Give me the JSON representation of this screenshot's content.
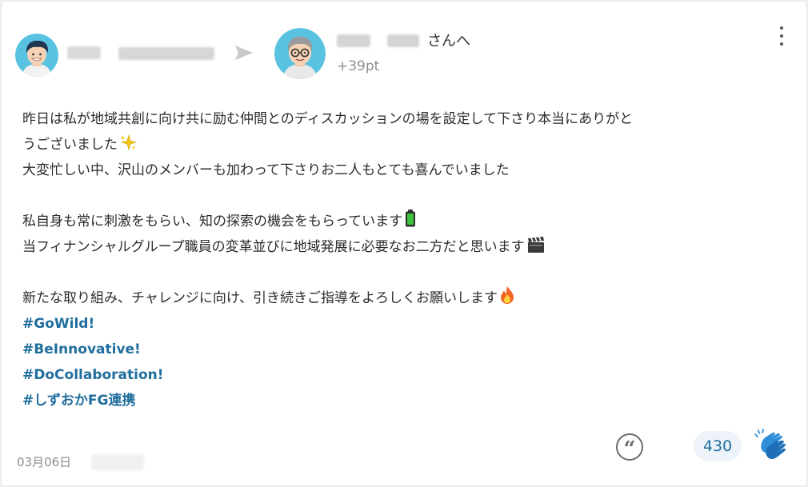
{
  "post": {
    "sender": {
      "name_redacted": true,
      "avatar_icon": "avatar-man-dark-hair-icon"
    },
    "recipient": {
      "name_suffix": "さんへ",
      "points": "+39pt",
      "avatar_icon": "avatar-man-glasses-icon"
    },
    "arrow_icon": "arrow-right-icon",
    "menu_icon": "more-vertical-icon",
    "message": {
      "line1": "昨日は私が地域共創に向け共に励む仲間とのディスカッションの場を設定して下さり本当にありがと",
      "line2": "うございました",
      "line3": "大変忙しい中、沢山のメンバーも加わって下さりお二人もとても喜んでいました",
      "line4": "私自身も常に刺激をもらい、知の探索の機会をもらっています",
      "line5": "当フィナンシャルグループ職員の変革並びに地域発展に必要なお二方だと思います",
      "line6": "新たな取り組み、チャレンジに向け、引き続きご指導をよろしくお願いします"
    },
    "hashtags": [
      "#GoWild!",
      "#BeInnovative!",
      "#DoCollaboration!",
      "#しずおかFG連携"
    ],
    "date": "03月06日",
    "quote_icon": "quote-icon",
    "clap_count": "430",
    "clap_icon": "clapping-hands-icon",
    "colors": {
      "accent": "#1f6e9d",
      "pill_bg": "#edf3f8",
      "muted": "#8e8e8e"
    }
  }
}
